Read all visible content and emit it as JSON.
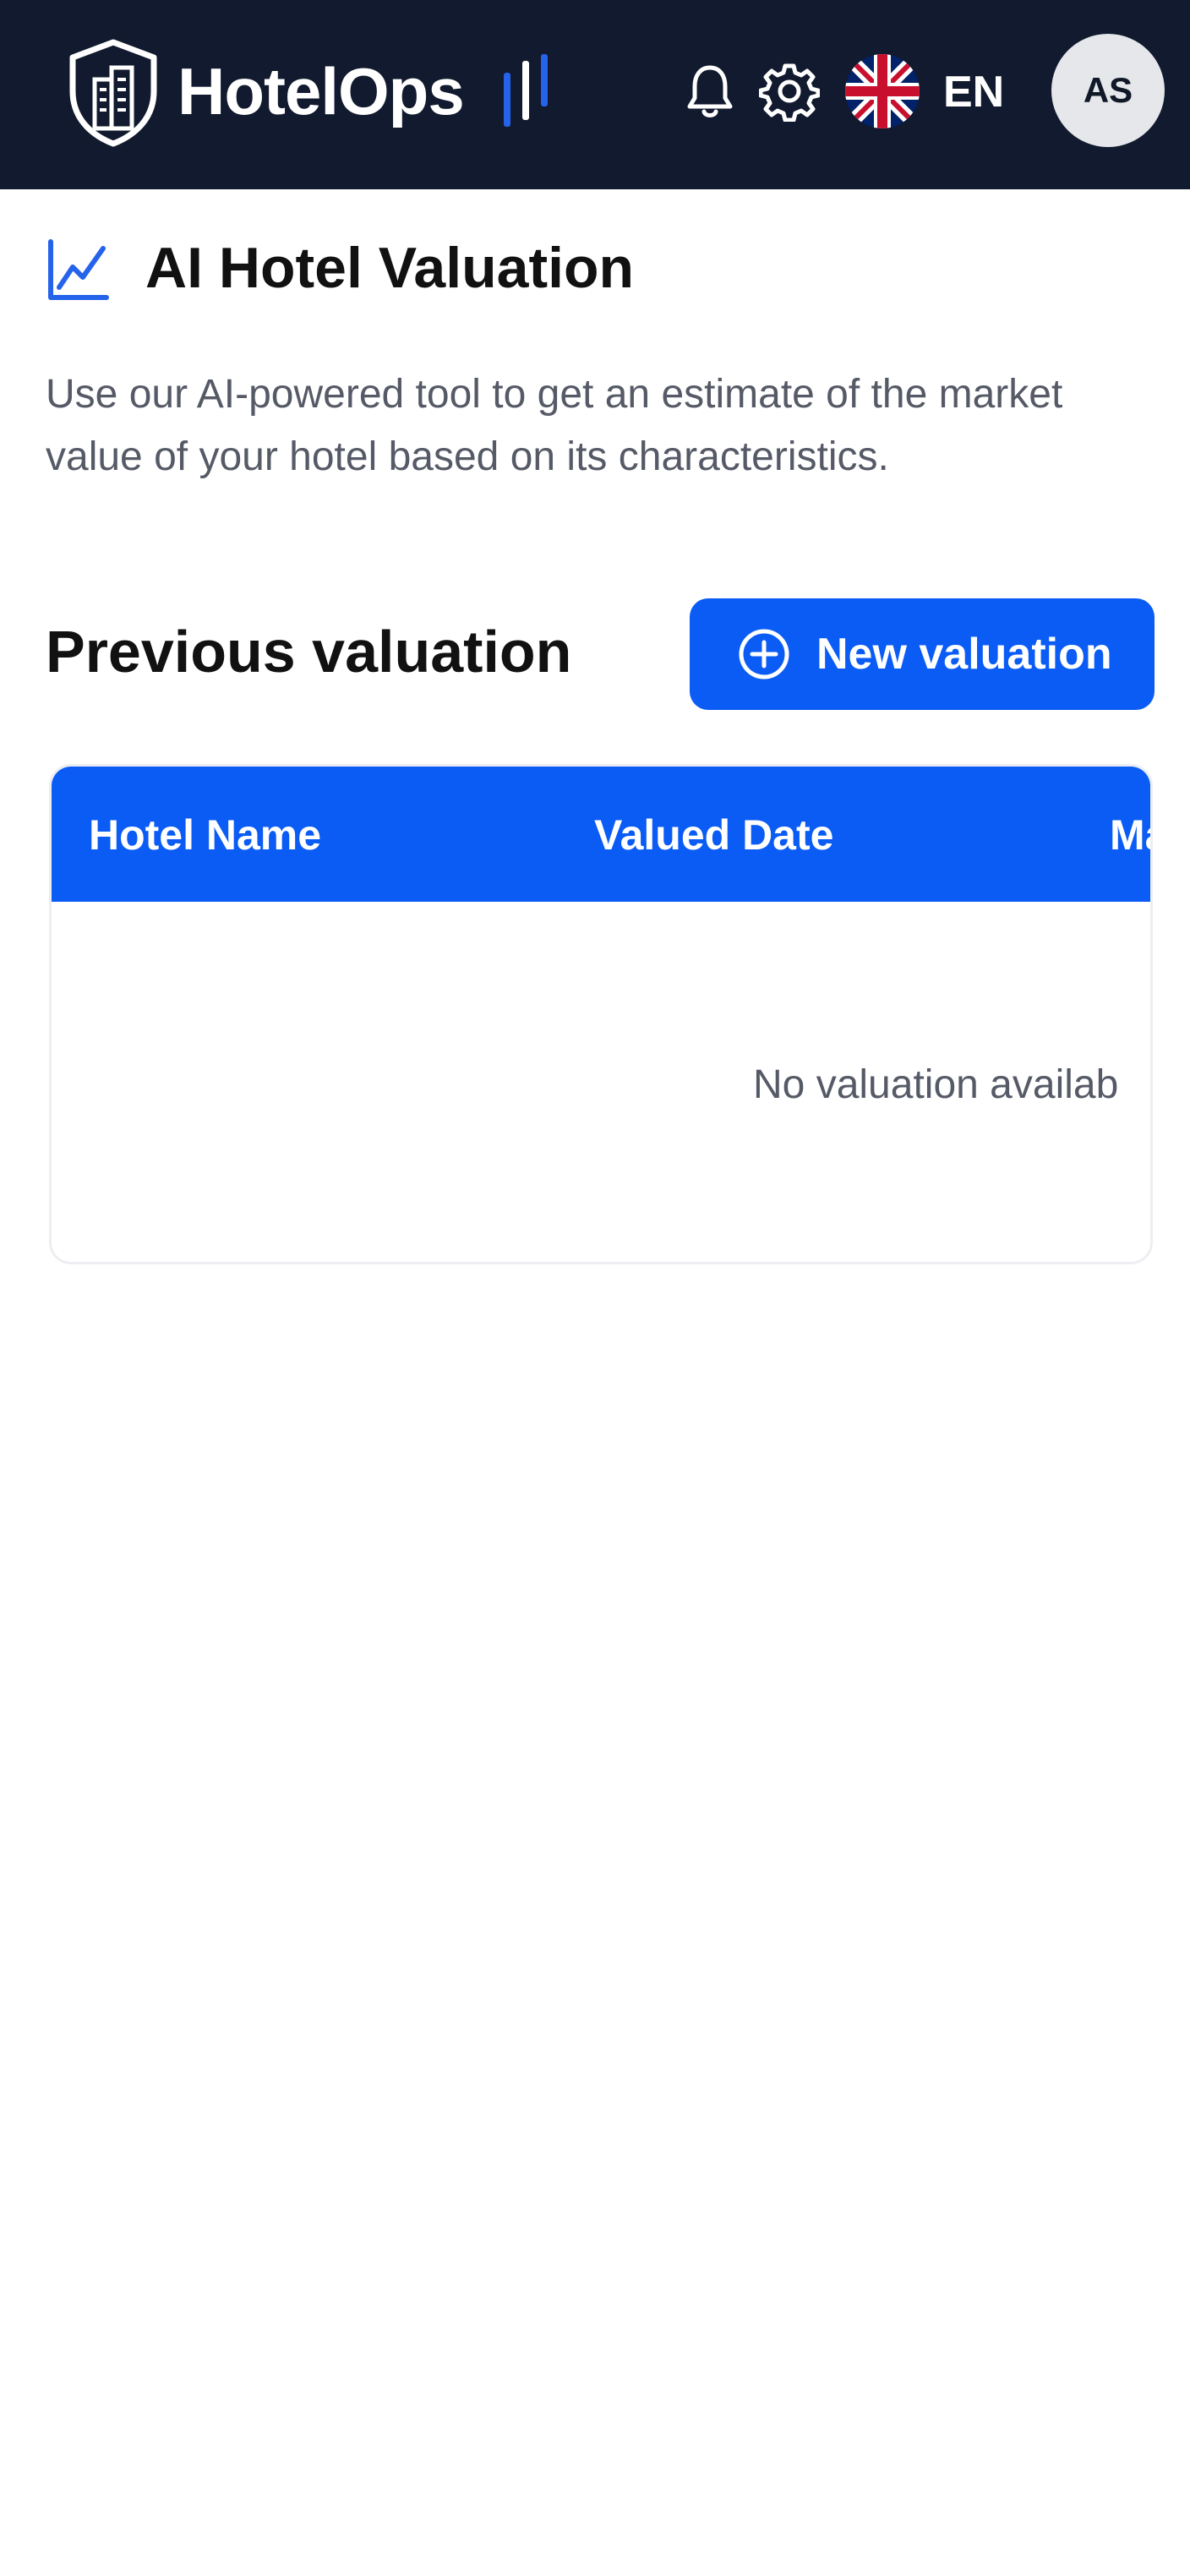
{
  "header": {
    "app_name": "HotelOps",
    "language": "EN",
    "avatar_initials": "AS",
    "icons": [
      "logo-shield-icon",
      "bell-icon",
      "gear-icon",
      "uk-flag-icon"
    ],
    "colors": {
      "background": "#111a2e",
      "accent": "#3b82f6"
    }
  },
  "page": {
    "title": "AI Hotel Valuation",
    "title_icon": "line-chart-icon",
    "description": "Use our AI-powered tool to get an estimate of the market value of your hotel based on its characteristics."
  },
  "valuations": {
    "section_title": "Previous valuation",
    "new_button_label": "New valuation",
    "new_button_icon": "plus-circle-icon",
    "columns": [
      "Hotel Name",
      "Valued Date",
      "Ma"
    ],
    "empty_message": "No valuation availab",
    "colors": {
      "primary": "#0a5cf5"
    }
  }
}
